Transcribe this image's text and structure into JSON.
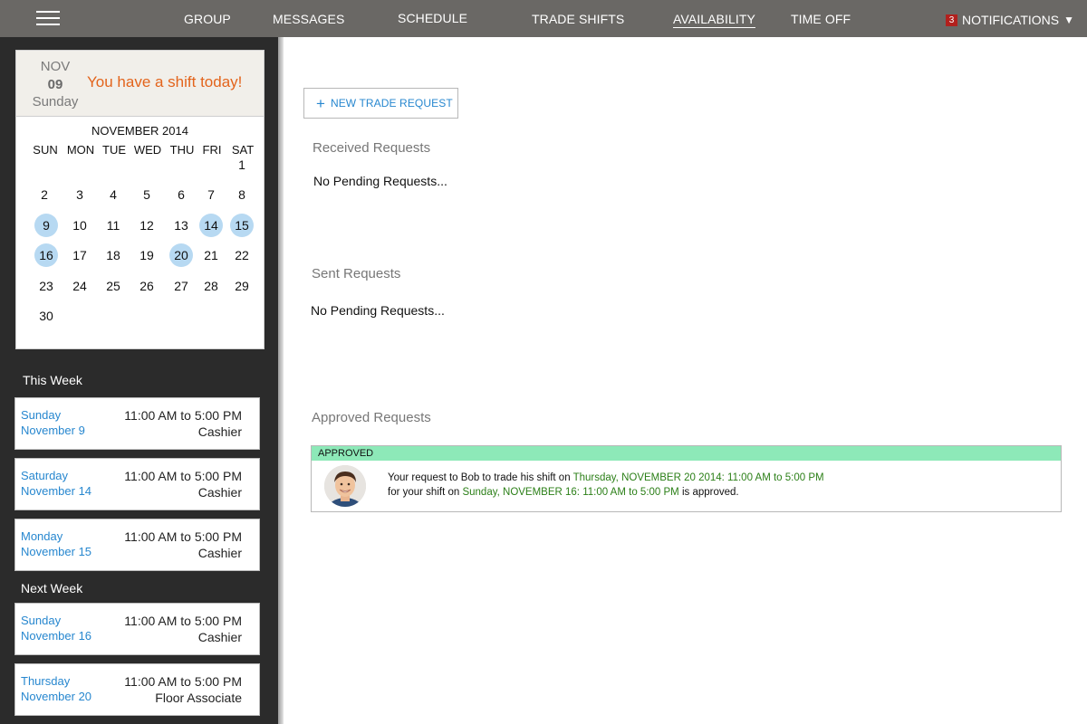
{
  "nav": {
    "items": [
      "GROUP",
      "MESSAGES",
      "SCHEDULE",
      "TRADE SHIFTS",
      "AVAILABILITY",
      "TIME OFF"
    ],
    "active": "AVAILABILITY",
    "notifications_count": "3",
    "notifications_label": "NOTIFICATIONS",
    "notifications_caret": "▼"
  },
  "today": {
    "month": "NOV",
    "day": "09",
    "weekday": "Sunday",
    "message": "You have a shift today!"
  },
  "calendar": {
    "title": "NOVEMBER 2014",
    "weekdays": [
      "SUN",
      "MON",
      "TUE",
      "WED",
      "THU",
      "FRI",
      "SAT"
    ],
    "highlighted": [
      9,
      14,
      15,
      16,
      20
    ]
  },
  "this_week": {
    "label": "This Week",
    "shifts": [
      {
        "weekday": "Sunday",
        "date": "November 9",
        "time": "11:00 AM to 5:00 PM",
        "role": "Cashier"
      },
      {
        "weekday": "Saturday",
        "date": "November 14",
        "time": "11:00 AM to 5:00 PM",
        "role": "Cashier"
      },
      {
        "weekday": "Monday",
        "date": "November 15",
        "time": "11:00 AM to 5:00 PM",
        "role": "Cashier"
      }
    ]
  },
  "next_week": {
    "label": "Next Week",
    "shifts": [
      {
        "weekday": "Sunday",
        "date": "November 16",
        "time": "11:00 AM to 5:00 PM",
        "role": "Cashier"
      },
      {
        "weekday": "Thursday",
        "date": "November 20",
        "time": "11:00 AM to 5:00 PM",
        "role": "Floor Associate"
      }
    ]
  },
  "main": {
    "new_trade_label": "NEW TRADE REQUEST",
    "received_heading": "Received Requests",
    "received_text": "No Pending Requests...",
    "sent_heading": "Sent Requests",
    "sent_text": "No Pending Requests...",
    "approved_heading": "Approved Requests",
    "approved": {
      "status": "APPROVED",
      "line1_prefix": "Your request to Bob to trade his  shift on ",
      "line1_highlight": "Thursday, NOVEMBER 20 2014: 11:00 AM to 5:00 PM",
      "line2_prefix": "for your shift on ",
      "line2_highlight": "Sunday, NOVEMBER 16: 11:00 AM to 5:00 PM",
      "line2_suffix": " is approved."
    }
  },
  "colors": {
    "accent_blue": "#2787cf",
    "shift_today_orange": "#e3641c",
    "approved_green": "#8de9b8",
    "highlight_green_text": "#2b7f17",
    "calendar_highlight": "#b7d9f2"
  }
}
